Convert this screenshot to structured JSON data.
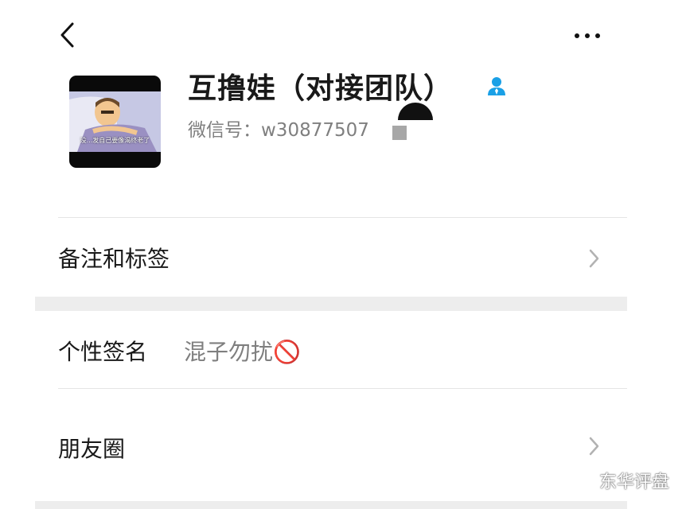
{
  "header": {
    "back_icon": "chevron-left-icon",
    "more_icon": "more-horizontal-icon"
  },
  "profile": {
    "avatar_caption": "没...发自己要像渴终老了",
    "name": "互撸娃（对接团队）",
    "contact_icon": "contact-person-icon",
    "contact_icon_color": "#1aa0e6",
    "wechat_id": "微信号：w30877507"
  },
  "rows": {
    "remarks_label": "备注和标签",
    "signature_label": "个性签名",
    "signature_value": "混子勿扰🚫",
    "moments_label": "朋友圈"
  },
  "watermark": {
    "text": "东华评盘"
  },
  "colors": {
    "page_bg": "#ffffff",
    "section_gap": "#ededed",
    "primary_text": "#191919",
    "secondary_text": "#7f7f7f"
  }
}
